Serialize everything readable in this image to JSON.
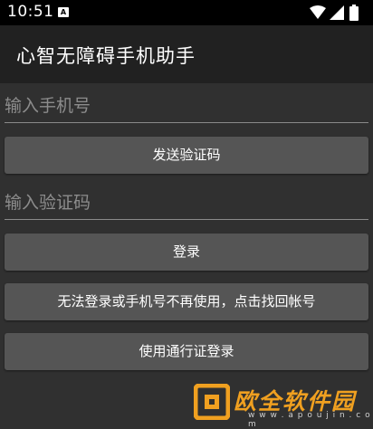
{
  "status_bar": {
    "time": "10:51",
    "notification_glyph": "A",
    "icons": [
      "wifi-icon",
      "signal-icon",
      "battery-icon"
    ]
  },
  "app_bar": {
    "title": "心智无障碍手机助手"
  },
  "form": {
    "phone_placeholder": "输入手机号",
    "send_code_label": "发送验证码",
    "code_placeholder": "输入验证码",
    "login_label": "登录",
    "recover_label": "无法登录或手机号不再使用，点击找回帐号",
    "pass_login_label": "使用通行证登录"
  },
  "watermark": {
    "brand": "欧全软件园",
    "url": "w w w . a p o u j i n . c o m"
  },
  "colors": {
    "background": "#303030",
    "app_bar": "#212121",
    "button": "#555555",
    "watermark_accent": "#f0a020"
  }
}
